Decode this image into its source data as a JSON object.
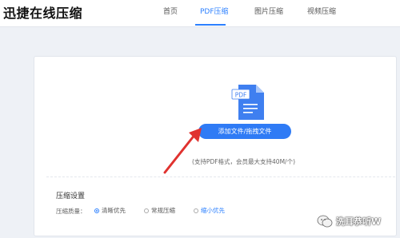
{
  "app": {
    "title": "迅捷在线压缩"
  },
  "nav": {
    "items": [
      {
        "label": "首页"
      },
      {
        "label": "PDF压缩"
      },
      {
        "label": "图片压缩"
      },
      {
        "label": "视频压缩"
      }
    ],
    "active_index": 1
  },
  "upload": {
    "icon_label": "PDF",
    "button_label": "添加文件/拖拽文件",
    "hint": "(支持PDF格式，会员最大支持40M/个)"
  },
  "settings": {
    "title": "压缩设置",
    "quality_label": "压缩质量：",
    "options": [
      {
        "label": "清晰优先",
        "selected": true
      },
      {
        "label": "常规压缩",
        "selected": false
      },
      {
        "label": "缩小优先",
        "selected": false
      }
    ]
  },
  "overlay": {
    "watermark_text": "洗耳恭听W",
    "arrow_color": "#e0322f"
  },
  "colors": {
    "accent": "#2c80ff",
    "button": "#2f7bf5"
  }
}
